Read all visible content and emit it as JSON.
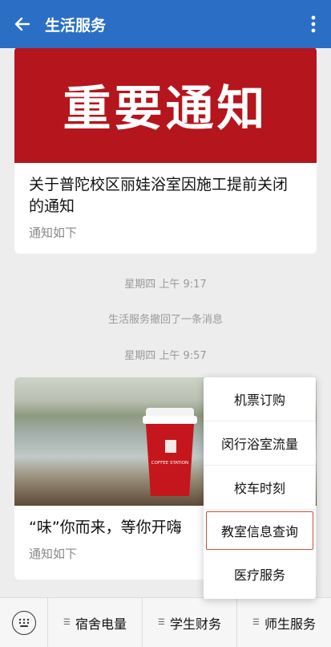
{
  "header": {
    "title": "生活服务"
  },
  "feed": {
    "card1": {
      "banner_text": "重要通知",
      "title": "关于普陀校区丽娃浴室因施工提前关闭的通知",
      "subtitle": "通知如下"
    },
    "time1": "星期四  上午 9:17",
    "recall_notice": "生活服务撤回了一条消息",
    "time2": "星期四  上午 9:57",
    "card2": {
      "cup_text": "COFFEE STATION",
      "title": "“味”你而来，等你开嗨",
      "subtitle": "通知如下"
    }
  },
  "popup_menu": {
    "items": [
      "机票订购",
      "闵行浴室流量",
      "校车时刻",
      "教室信息查询",
      "医疗服务"
    ],
    "highlighted": "教室信息查询"
  },
  "bottom_tabs": [
    "宿舍电量",
    "学生财务",
    "师生服务"
  ],
  "colors": {
    "header": "#2a6fc5",
    "banner": "#b5151d",
    "cup": "#c4161c",
    "highlight": "#d94a3c"
  },
  "icons": {
    "back": "arrow-left-icon",
    "more": "more-vertical-icon",
    "keyboard": "keyboard-icon",
    "tab": "menu-lines-icon"
  }
}
